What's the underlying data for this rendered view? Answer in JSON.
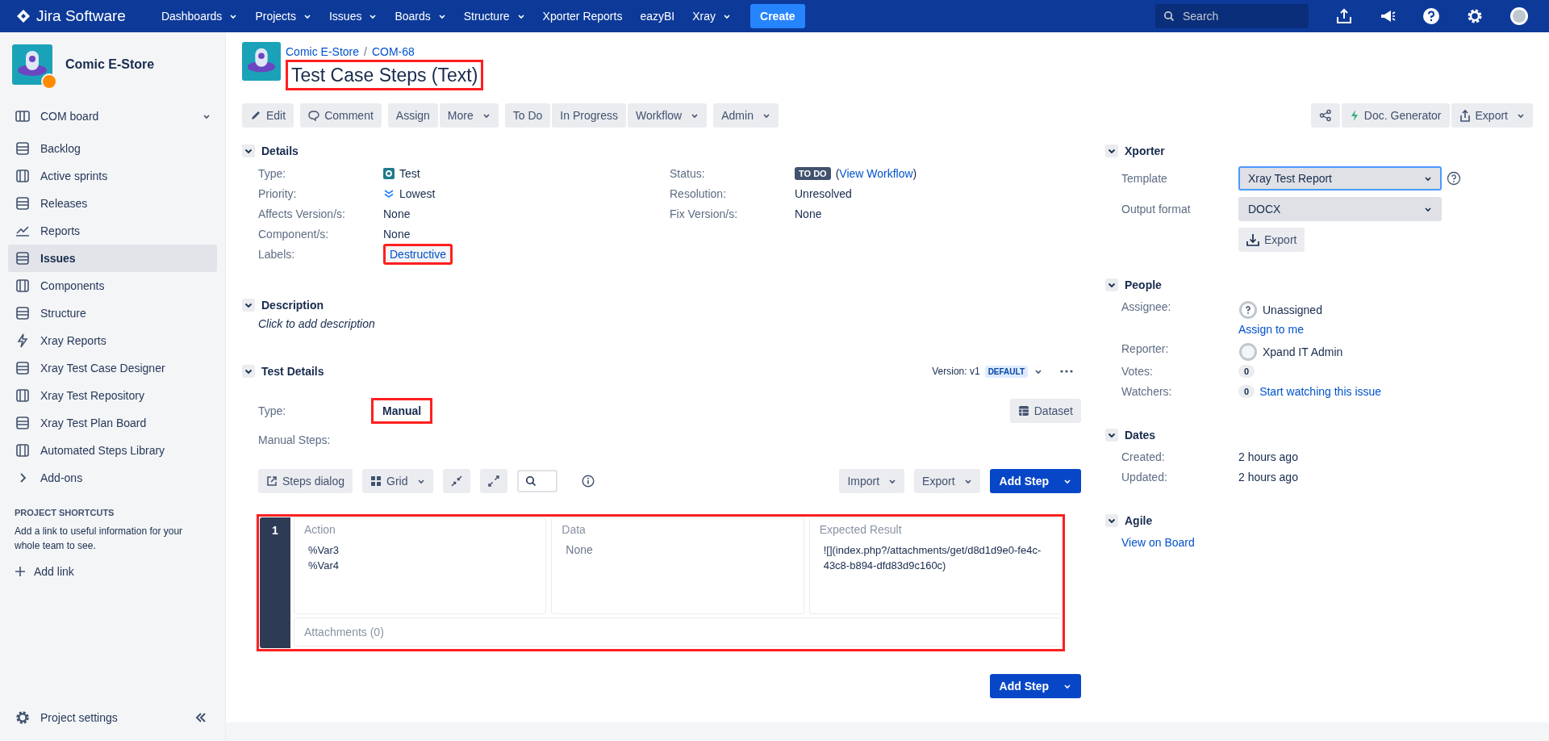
{
  "nav": {
    "logo": "Jira Software",
    "items": [
      {
        "label": "Dashboards",
        "dropdown": true
      },
      {
        "label": "Projects",
        "dropdown": true
      },
      {
        "label": "Issues",
        "dropdown": true
      },
      {
        "label": "Boards",
        "dropdown": true
      },
      {
        "label": "Structure",
        "dropdown": true
      },
      {
        "label": "Xporter Reports",
        "dropdown": false
      },
      {
        "label": "eazyBI",
        "dropdown": false
      },
      {
        "label": "Xray",
        "dropdown": true
      }
    ],
    "create": "Create",
    "search_placeholder": "Search"
  },
  "sidebar": {
    "project": "Comic E-Store",
    "board": "COM board",
    "items": [
      {
        "label": "Backlog",
        "selected": false
      },
      {
        "label": "Active sprints",
        "selected": false
      },
      {
        "label": "Releases",
        "selected": false
      },
      {
        "label": "Reports",
        "selected": false
      },
      {
        "label": "Issues",
        "selected": true
      },
      {
        "label": "Components",
        "selected": false
      },
      {
        "label": "Structure",
        "selected": false
      },
      {
        "label": "Xray Reports",
        "selected": false
      },
      {
        "label": "Xray Test Case Designer",
        "selected": false
      },
      {
        "label": "Xray Test Repository",
        "selected": false
      },
      {
        "label": "Xray Test Plan Board",
        "selected": false
      },
      {
        "label": "Automated Steps Library",
        "selected": false
      },
      {
        "label": "Add-ons",
        "selected": false
      }
    ],
    "shortcuts_heading": "PROJECT SHORTCUTS",
    "shortcuts_text": "Add a link to useful information for your whole team to see.",
    "add_link": "Add link",
    "settings": "Project settings"
  },
  "issue": {
    "breadcrumb": [
      "Comic E-Store",
      "COM-68"
    ],
    "breadcrumb_separator": "/",
    "title": "Test Case Steps (Text)",
    "title_highlighted": true,
    "toolbar": [
      [
        {
          "label": "Edit",
          "dropdown": false
        }
      ],
      [
        {
          "label": "Comment",
          "dropdown": false
        }
      ],
      [
        {
          "label": "Assign",
          "dropdown": false
        },
        {
          "label": "More",
          "dropdown": true
        }
      ],
      [
        {
          "label": "To Do",
          "dropdown": false
        },
        {
          "label": "In Progress",
          "dropdown": false
        },
        {
          "label": "Workflow",
          "dropdown": true
        }
      ],
      [
        {
          "label": "Admin",
          "dropdown": true
        }
      ]
    ],
    "toolbar_right": [
      {
        "label": "Doc. Generator",
        "dropdown": false
      },
      {
        "label": "Export",
        "dropdown": true
      }
    ]
  },
  "details": {
    "title": "Details",
    "left": [
      {
        "label": "Type:",
        "value": "Test",
        "kind": "type"
      },
      {
        "label": "Priority:",
        "value": "Lowest",
        "kind": "priority"
      },
      {
        "label": "Affects Version/s:",
        "value": "None",
        "kind": "text"
      },
      {
        "label": "Component/s:",
        "value": "None",
        "kind": "text"
      },
      {
        "label": "Labels:",
        "value": "Destructive",
        "kind": "label",
        "highlighted": true
      }
    ],
    "right": [
      {
        "label": "Status:",
        "value": "TO DO",
        "paren_open": "(",
        "link": "View Workflow",
        "paren_close": ")",
        "kind": "status"
      },
      {
        "label": "Resolution:",
        "value": "Unresolved",
        "kind": "text"
      },
      {
        "label": "Fix Version/s:",
        "value": "None",
        "kind": "text"
      }
    ]
  },
  "description": {
    "title": "Description",
    "placeholder": "Click to add description"
  },
  "test_details": {
    "title": "Test Details",
    "version_label": "Version: v1",
    "version_badge": "DEFAULT",
    "type_label": "Type:",
    "type_value": "Manual",
    "type_highlighted": true,
    "dataset": "Dataset",
    "steps_label": "Manual Steps:",
    "steps_toolbar": [
      {
        "label": "Steps dialog",
        "dropdown": false
      },
      {
        "label": "Grid",
        "dropdown": true
      }
    ],
    "import": "Import",
    "export": "Export",
    "add_step": "Add Step",
    "columns": [
      "Action",
      "Data",
      "Expected Result"
    ],
    "steps_highlighted": true,
    "steps": [
      {
        "number": "1",
        "action": [
          "%Var3",
          "%Var4"
        ],
        "data": "None",
        "expected": "![](index.php?/attachments/get/d8d1d9e0-fe4c-43c8-b894-dfd83d9c160c)",
        "attachments": "Attachments (0)"
      }
    ],
    "add_step_bottom": "Add Step"
  },
  "xporter": {
    "title": "Xporter",
    "template_label": "Template",
    "template": "Xray Test Report",
    "format_label": "Output format",
    "format": "DOCX",
    "export": "Export"
  },
  "people": {
    "title": "People",
    "assignee_label": "Assignee:",
    "assignee": "Unassigned",
    "assign_to_me": "Assign to me",
    "reporter_label": "Reporter:",
    "reporter": "Xpand IT Admin",
    "votes_label": "Votes:",
    "votes": "0",
    "watchers_label": "Watchers:",
    "watchers": "0",
    "watch_link": "Start watching this issue"
  },
  "dates": {
    "title": "Dates",
    "rows": [
      {
        "label": "Created:",
        "value": "2 hours ago"
      },
      {
        "label": "Updated:",
        "value": "2 hours ago"
      }
    ]
  },
  "agile": {
    "title": "Agile",
    "link": "View on Board"
  }
}
